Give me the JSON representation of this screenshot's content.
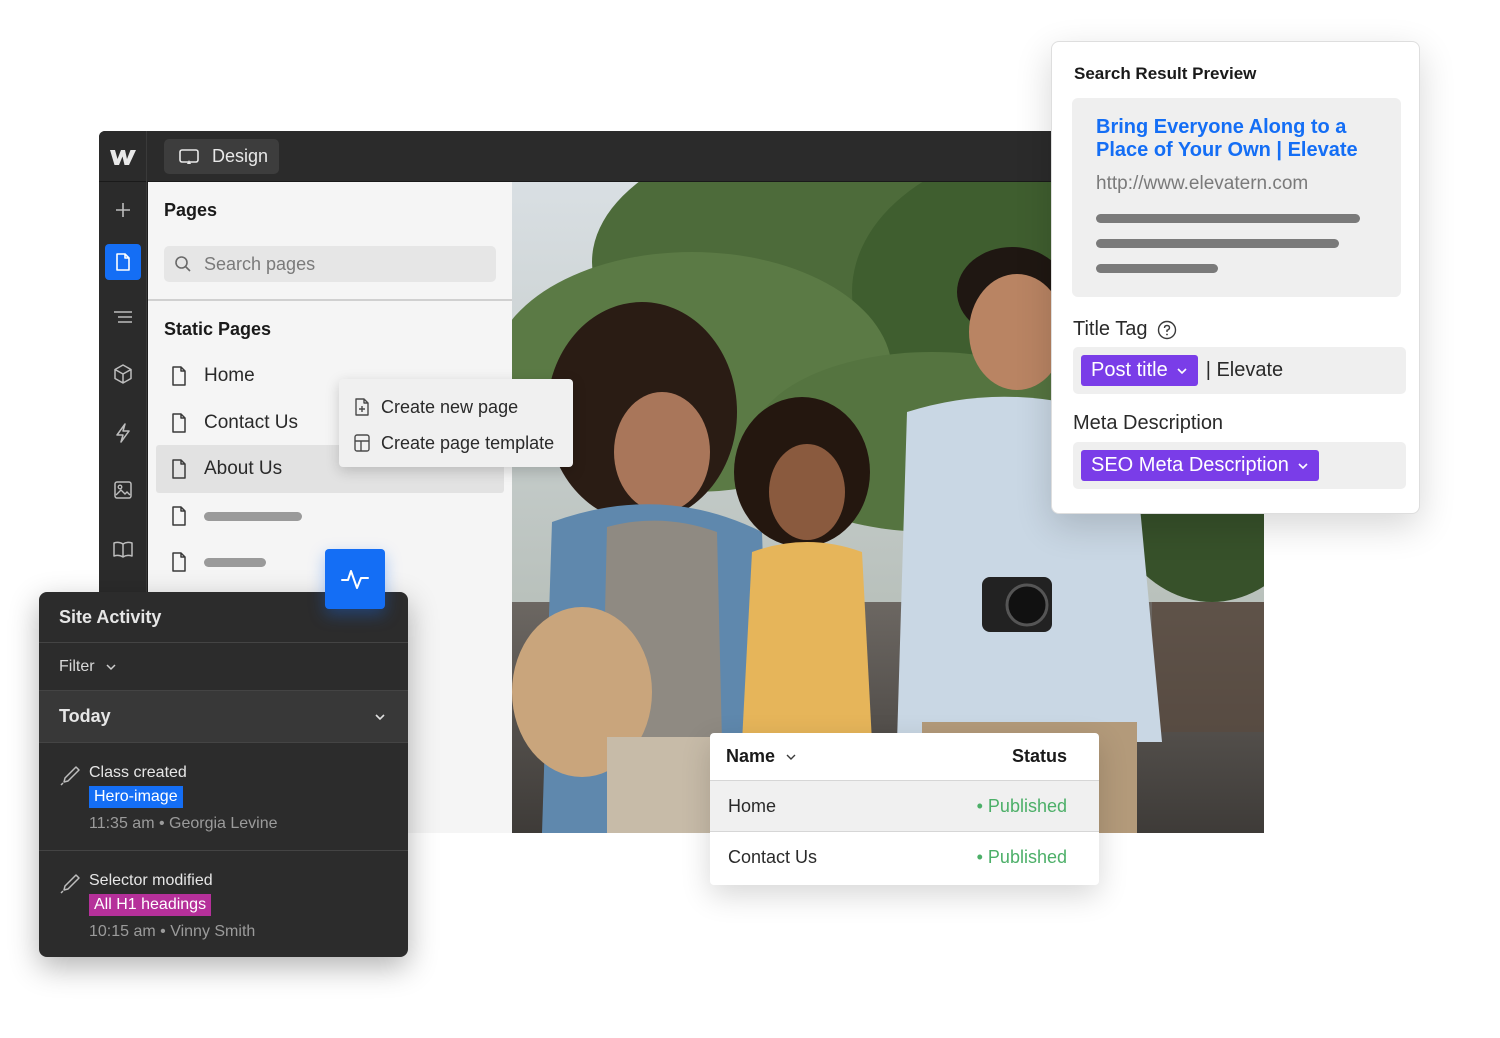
{
  "editor": {
    "mode_label": "Design",
    "pages_title": "Pages",
    "search_placeholder": "Search pages",
    "static_pages_title": "Static Pages",
    "pages": [
      {
        "label": "Home"
      },
      {
        "label": "Contact Us"
      },
      {
        "label": "About Us"
      }
    ]
  },
  "context_menu": {
    "items": [
      {
        "label": "Create new page",
        "icon": "new-page-icon"
      },
      {
        "label": "Create page template",
        "icon": "template-icon"
      }
    ]
  },
  "site_activity": {
    "title": "Site Activity",
    "filter_label": "Filter",
    "group_label": "Today",
    "entries": [
      {
        "title": "Class created",
        "tag": "Hero-image",
        "tag_color": "#146ef5",
        "meta": "11:35 am • Georgia Levine"
      },
      {
        "title": "Selector modified",
        "tag": "All H1 headings",
        "tag_color": "#b5309a",
        "meta": "10:15 am • Vinny Smith"
      }
    ]
  },
  "seo_preview": {
    "title": "Search Result Preview",
    "result_title": "Bring Everyone Along to a Place of Your Own | Elevate",
    "result_url": "http://www.elevatern.com",
    "title_tag_label": "Title Tag",
    "title_tag_pill": "Post title",
    "title_tag_suffix": "| Elevate",
    "meta_description_label": "Meta Description",
    "meta_description_pill": "SEO Meta Description"
  },
  "status_table": {
    "col_name": "Name",
    "col_status": "Status",
    "rows": [
      {
        "name": "Home",
        "status": "• Published"
      },
      {
        "name": "Contact Us",
        "status": "• Published"
      }
    ]
  },
  "colors": {
    "accent": "#146ef5",
    "pill_purple": "#7a3de8",
    "published_green": "#4caf68"
  }
}
